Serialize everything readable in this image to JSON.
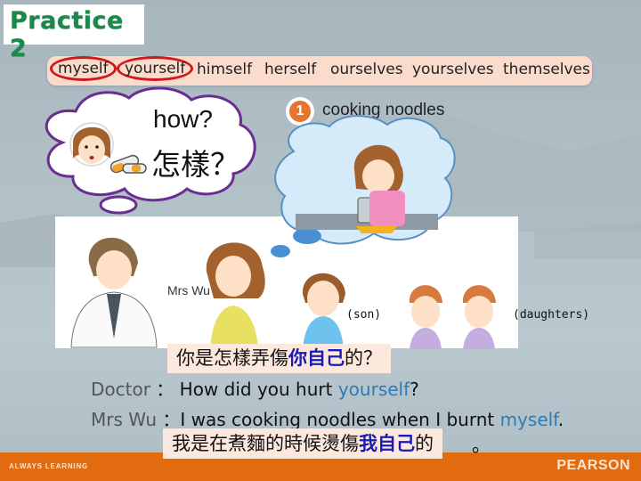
{
  "title": "Practice 2",
  "word_bank": {
    "words": [
      "myself",
      "yourself",
      "himself",
      "herself",
      "ourselves",
      "yourselves",
      "themselves"
    ],
    "circled": [
      "myself",
      "yourself"
    ]
  },
  "thought_bubble": {
    "question_en": "how?",
    "question_zh": "怎樣？"
  },
  "scene": {
    "step_number": "1",
    "step_label": "cooking noodles",
    "characters": {
      "mother": "Mrs Wu",
      "son": "(son)",
      "daughters": "(daughters)"
    }
  },
  "dialog": {
    "line1_zh_pre": "你是怎樣弄傷",
    "line1_zh_hl": "你自己",
    "line1_zh_post": "的？",
    "line1_speaker": "Doctor",
    "line1_sep": " ：",
    "line1_text": "How did you hurt ",
    "line1_answer": "yourself",
    "line1_end": "?",
    "line2_speaker": "Mrs Wu",
    "line2_sep": "：",
    "line2_text": "I was cooking noodles when I burnt ",
    "line2_answer": "myself",
    "line2_end": ".",
    "line2_zh_pre": "我是在煮麵的時候燙傷",
    "line2_zh_hl": "我自己",
    "line2_zh_post": "的",
    "line2_zh_end": "。"
  },
  "footer": {
    "tagline": "ALWAYS LEARNING",
    "brand": "PEARSON"
  },
  "colors": {
    "title_green": "#1a8a4a",
    "circle_red": "#d0181e",
    "answer_blue": "#2e7ab8",
    "zh_highlight": "#1a1ab4",
    "footer_orange": "#e26a0f"
  }
}
